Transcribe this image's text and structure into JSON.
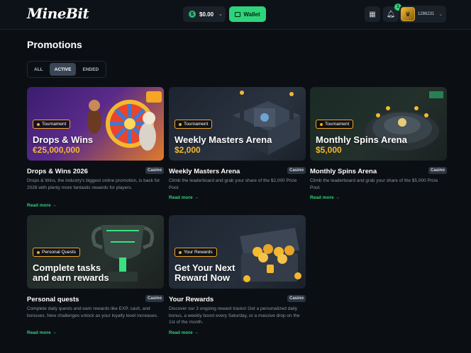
{
  "header": {
    "logo": "MineBit",
    "balance": "$0.00",
    "wallet_label": "Wallet",
    "notification_count": "1",
    "username": "1286231"
  },
  "page": {
    "title": "Promotions",
    "tabs": [
      {
        "label": "ALL",
        "active": false
      },
      {
        "label": "ACTIVE",
        "active": true
      },
      {
        "label": "ENDED",
        "active": false
      }
    ]
  },
  "cards": [
    {
      "tag": "Tournament",
      "banner_title": "Drops & Wins",
      "banner_amount": "€25,000,000",
      "title": "Drops & Wins 2026",
      "badge": "Casino",
      "description": "Drops & Wins, the industry's biggest online promotion, is back for 2026 with plenty more fantastic rewards for players.",
      "read_more": "Read more →"
    },
    {
      "tag": "Tournament",
      "banner_title": "Weekly Masters Arena",
      "banner_amount": "$2,000",
      "title": "Weekly Masters Arena",
      "badge": "Casino",
      "description": "Climb the leaderboard and grab your share of the $2,000 Prize Pool.",
      "read_more": "Read more →"
    },
    {
      "tag": "Tournament",
      "banner_title": "Monthly Spins Arena",
      "banner_amount": "$5,000",
      "title": "Monthly Spins Arena",
      "badge": "Casino",
      "description": "Climb the leaderboard and grab your share of the $5,000 Prize Pool.",
      "read_more": "Read more →"
    },
    {
      "tag": "Personal Quests",
      "banner_title": "Complete tasks and earn rewards",
      "title": "Personal quests",
      "badge": "Casino",
      "description": "Complete daily quests and earn rewards like EXP, cash, and bonuses. New challenges unlock as your loyalty level increases.",
      "read_more": "Read more →"
    },
    {
      "tag": "Your Rewards",
      "banner_title": "Get Your Next Reward Now",
      "title": "Your Rewards",
      "badge": "Casino",
      "description": "Discover our 3 ongoing reward tracks! Get a personalized daily bonus, a weekly boost every Saturday, or a massive drop on the 1st of the month.",
      "read_more": "Read more →"
    }
  ],
  "colors": {
    "accent": "#2ed47a",
    "gold": "#f5b82e",
    "tag_border": "#f5a623",
    "background": "#0b0f14"
  }
}
